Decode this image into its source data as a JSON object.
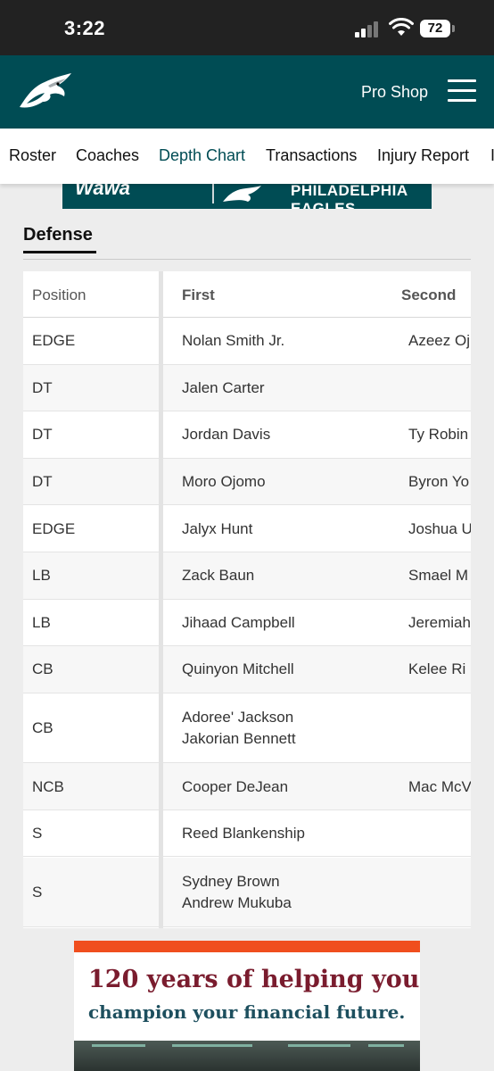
{
  "status_bar": {
    "time": "3:22",
    "battery": "72"
  },
  "header": {
    "pro_shop": "Pro Shop"
  },
  "tabs": [
    {
      "label": "Roster"
    },
    {
      "label": "Coaches"
    },
    {
      "label": "Depth Chart",
      "active": true
    },
    {
      "label": "Transactions"
    },
    {
      "label": "Injury Report"
    },
    {
      "label": "I"
    }
  ],
  "banner_ad": {
    "brand": "Wawa",
    "text": "PHILADELPHIA EAGLES"
  },
  "section": {
    "title": "Defense"
  },
  "table": {
    "headers": {
      "position": "Position",
      "first": "First",
      "second": "Second"
    },
    "rows": [
      {
        "position": "EDGE",
        "first": [
          "Nolan Smith Jr."
        ],
        "second": [
          "Azeez Oj"
        ]
      },
      {
        "position": "DT",
        "first": [
          "Jalen Carter"
        ],
        "second": []
      },
      {
        "position": "DT",
        "first": [
          "Jordan Davis"
        ],
        "second": [
          "Ty Robin"
        ]
      },
      {
        "position": "DT",
        "first": [
          "Moro Ojomo"
        ],
        "second": [
          "Byron Yo"
        ]
      },
      {
        "position": "EDGE",
        "first": [
          "Jalyx Hunt"
        ],
        "second": [
          "Joshua U"
        ]
      },
      {
        "position": "LB",
        "first": [
          "Zack Baun"
        ],
        "second": [
          "Smael M"
        ]
      },
      {
        "position": "LB",
        "first": [
          "Jihaad Campbell"
        ],
        "second": [
          "Jeremiah"
        ]
      },
      {
        "position": "CB",
        "first": [
          "Quinyon Mitchell"
        ],
        "second": [
          "Kelee Ri"
        ]
      },
      {
        "position": "CB",
        "first": [
          "Adoree' Jackson",
          "Jakorian Bennett"
        ],
        "second": []
      },
      {
        "position": "NCB",
        "first": [
          "Cooper DeJean"
        ],
        "second": [
          "Mac McV"
        ]
      },
      {
        "position": "S",
        "first": [
          "Reed Blankenship"
        ],
        "second": []
      },
      {
        "position": "S",
        "first": [
          "Sydney Brown",
          "Andrew Mukuba"
        ],
        "second": []
      }
    ]
  },
  "promo": {
    "line1": "120 years of helping you",
    "line2": "champion your financial future."
  },
  "colors": {
    "brand_green": "#004c54",
    "promo_orange": "#f04e1e",
    "promo_maroon": "#7a1c2e",
    "promo_teal": "#1d4f5e"
  },
  "icons": {
    "logo": "eagles-logo-icon",
    "menu": "hamburger-menu-icon",
    "wifi": "wifi-icon",
    "signal": "cellular-signal-icon",
    "battery": "battery-icon"
  }
}
